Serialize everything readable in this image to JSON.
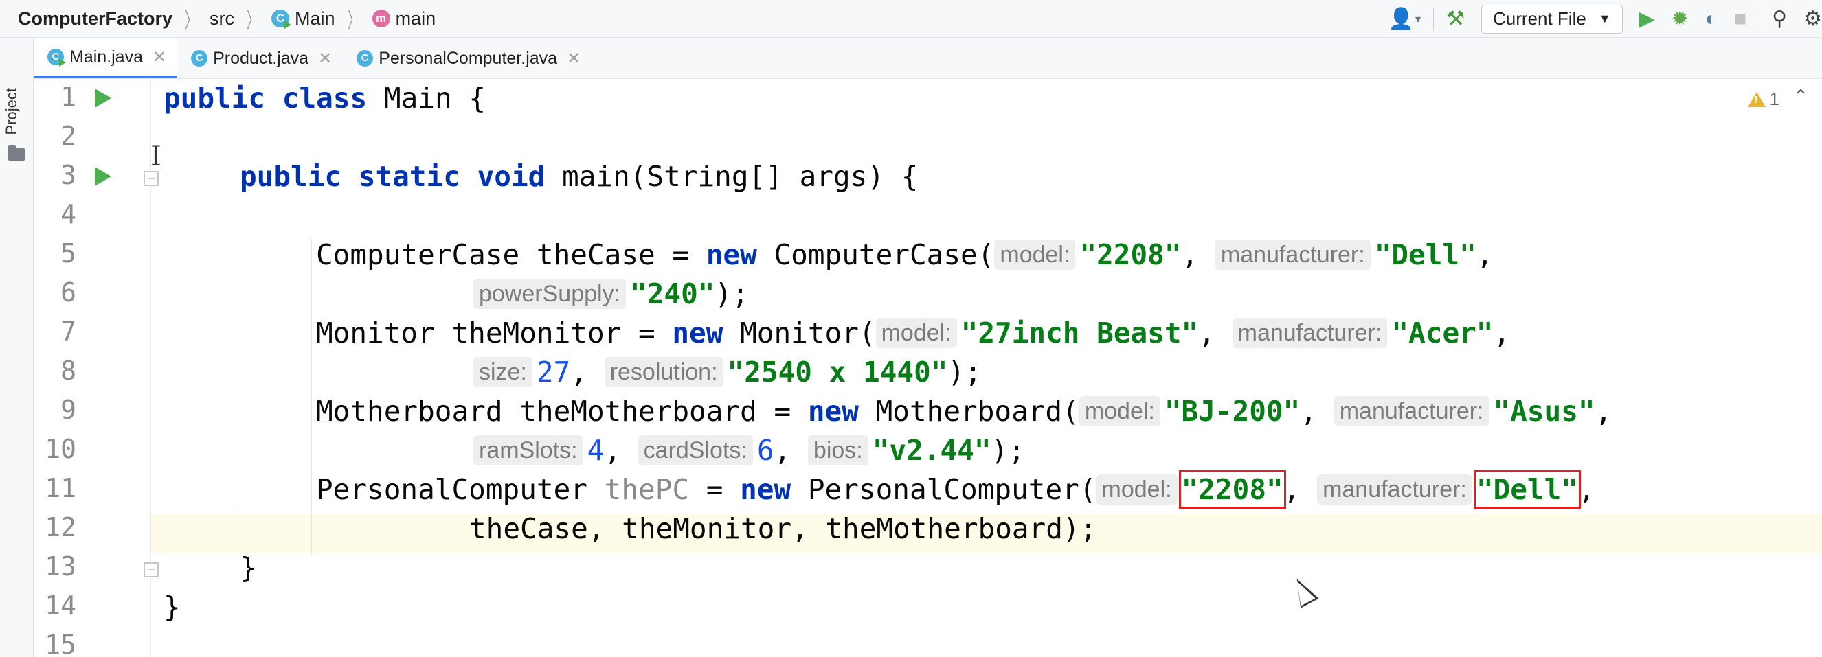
{
  "navbar": {
    "project": "ComputerFactory",
    "crumbs": [
      "src",
      "Main",
      "main"
    ],
    "run_config": "Current File"
  },
  "sidebar": {
    "project_label": "Project"
  },
  "tabs": [
    {
      "label": "Main.java",
      "active": true
    },
    {
      "label": "Product.java",
      "active": false
    },
    {
      "label": "PersonalComputer.java",
      "active": false
    }
  ],
  "editor": {
    "warnings_count": "1",
    "line_numbers": [
      "1",
      "2",
      "3",
      "4",
      "5",
      "6",
      "7",
      "8",
      "9",
      "10",
      "11",
      "12",
      "13",
      "14",
      "15"
    ],
    "current_line": 12,
    "code": {
      "l1": {
        "kw": "public class",
        "rest": " Main {"
      },
      "l3": {
        "kw": "public static void",
        "rest": " main(String[] args) {"
      },
      "l5": {
        "type": "ComputerCase theCase = ",
        "kw": "new",
        "call": " ComputerCase(",
        "h1": "model:",
        "s1": "\"2208\"",
        "sep1": ", ",
        "h2": "manufacturer:",
        "s2": "\"Dell\"",
        "end": ","
      },
      "l6": {
        "h1": "powerSupply:",
        "s1": "\"240\"",
        "end": ");"
      },
      "l7": {
        "type": "Monitor theMonitor = ",
        "kw": "new",
        "call": " Monitor(",
        "h1": "model:",
        "s1": "\"27inch Beast\"",
        "sep1": ", ",
        "h2": "manufacturer:",
        "s2": "\"Acer\"",
        "end": ","
      },
      "l8": {
        "h1": "size:",
        "n1": "27",
        "sep1": ", ",
        "h2": "resolution:",
        "s2": "\"2540 x 1440\"",
        "end": ");"
      },
      "l9": {
        "type": "Motherboard theMotherboard = ",
        "kw": "new",
        "call": " Motherboard(",
        "h1": "model:",
        "s1": "\"BJ-200\"",
        "sep1": ", ",
        "h2": "manufacturer:",
        "s2": "\"Asus\"",
        "end": ","
      },
      "l10": {
        "h1": "ramSlots:",
        "n1": "4",
        "sep1": ", ",
        "h2": "cardSlots:",
        "n2": "6",
        "sep2": ", ",
        "h3": "bios:",
        "s3": "\"v2.44\"",
        "end": ");"
      },
      "l11": {
        "type": "PersonalComputer ",
        "var": "thePC",
        "eq": " = ",
        "kw": "new",
        "call": " PersonalComputer(",
        "h1": "model:",
        "s1": "\"2208\"",
        "sep1": ", ",
        "h2": "manufacturer:",
        "s2": "\"Dell\"",
        "end": ","
      },
      "l12": {
        "text": "theCase, theMonitor, theMotherboard);"
      },
      "l13": {
        "text": "}"
      },
      "l14": {
        "text": "}"
      }
    }
  },
  "colors": {
    "keyword": "#0033b3",
    "string": "#067d17",
    "number": "#1750eb",
    "highlight_box": "#e02020",
    "current_line": "#fefbe9",
    "run_icon": "#4caf50"
  }
}
